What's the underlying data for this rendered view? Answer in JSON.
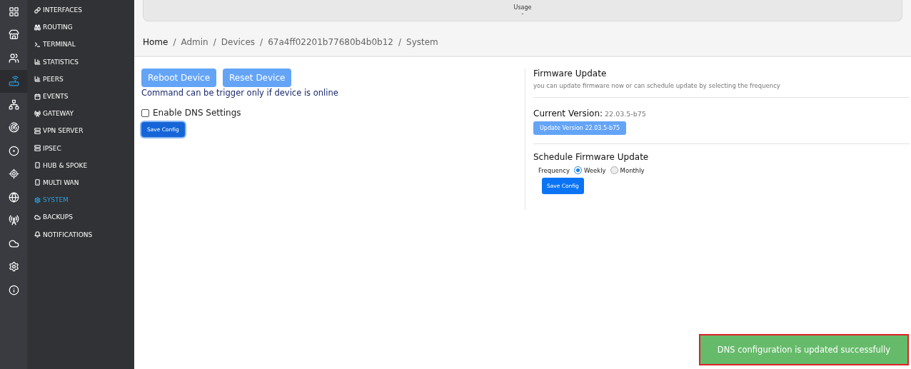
{
  "rail": [
    {
      "selected": false
    },
    {
      "selected": false
    },
    {
      "selected": false
    },
    {
      "selected": true
    },
    {
      "selected": false
    },
    {
      "selected": false
    },
    {
      "selected": false
    },
    {
      "selected": false
    },
    {
      "selected": false
    },
    {
      "selected": false
    },
    {
      "selected": false
    },
    {
      "selected": false
    },
    {
      "selected": false
    }
  ],
  "menu": [
    {
      "label": "INTERFACES",
      "selected": false
    },
    {
      "label": "ROUTING",
      "selected": false
    },
    {
      "label": "TERMINAL",
      "selected": false
    },
    {
      "label": "STATISTICS",
      "selected": false
    },
    {
      "label": "PEERS",
      "selected": false
    },
    {
      "label": "EVENTS",
      "selected": false
    },
    {
      "label": "GATEWAY",
      "selected": false
    },
    {
      "label": "VPN SERVER",
      "selected": false
    },
    {
      "label": "IPSEC",
      "selected": false
    },
    {
      "label": "HUB & SPOKE",
      "selected": false
    },
    {
      "label": "MULTI WAN",
      "selected": false
    },
    {
      "label": "SYSTEM",
      "selected": true
    },
    {
      "label": "BACKUPS",
      "selected": false
    },
    {
      "label": "NOTIFICATIONS",
      "selected": false
    }
  ],
  "usage_card": {
    "label": "Usage",
    "value": "-"
  },
  "breadcrumb": {
    "items": [
      "Home",
      "Admin",
      "Devices",
      "67a4ff02201b77680b4b0b12",
      "System"
    ],
    "separators": [
      "/",
      "/",
      "/",
      "/"
    ]
  },
  "device": {
    "buttons": [
      "Reboot Device",
      "Reset Device"
    ],
    "note": "Command can be trigger only if device is online",
    "dns_checkbox": {
      "label": "Enable DNS Settings",
      "checked": false
    },
    "save_button": "Save Config"
  },
  "firmware": {
    "title": "Firmware Update",
    "description": "you can update firmware now or can schedule update by selecting the frequency",
    "current_label": "Current Version:",
    "current_value": "22.03.5-b75",
    "update_button": "Update Version 22.03.5-b75",
    "schedule_title": "Schedule Firmware Update",
    "frequency_label": "Frequency",
    "options": [
      {
        "label": "Weekly",
        "selected": true
      },
      {
        "label": "Monthly",
        "selected": false
      }
    ],
    "save_button": "Save Config"
  },
  "toast": "DNS configuration is updated successfully"
}
